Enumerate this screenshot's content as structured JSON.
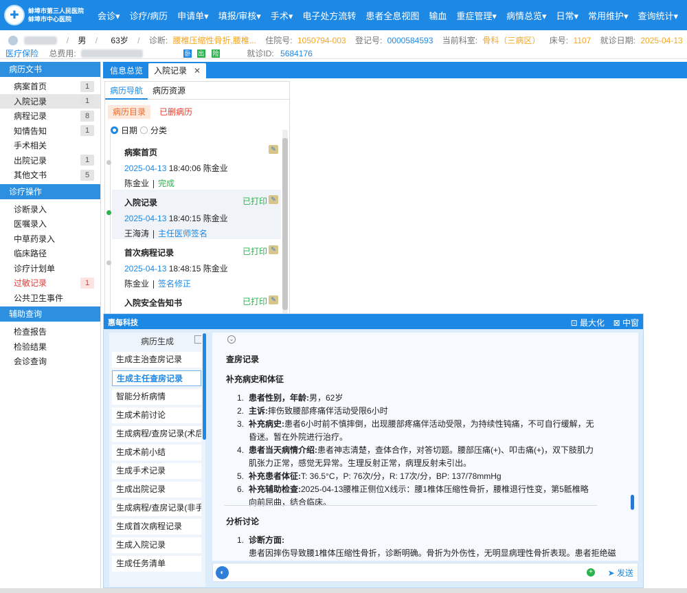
{
  "hospital": {
    "name1": "蚌埠市第三人民医院",
    "name2": "蚌埠市中心医院"
  },
  "menu": [
    "会诊▾",
    "诊疗/病历",
    "申请单▾",
    "填报/审核▾",
    "手术▾",
    "电子处方流转",
    "患者全息视图",
    "输血",
    "重症管理▾",
    "病情总览▾",
    "日常▾",
    "常用维护▾",
    "查询统计▾"
  ],
  "patient": {
    "gender": "男",
    "age": "63岁",
    "diag_label": "诊断:",
    "diag": "腰椎压缩性骨折,腰椎...",
    "inpatient_label": "住院号:",
    "inpatient": "1050794-003",
    "reg_label": "登记号:",
    "reg": "0000584593",
    "dept_label": "当前科室:",
    "dept": "骨科（三病区）",
    "bed_label": "床号:",
    "bed": "1107",
    "visit_label": "就诊日期:",
    "visit": "2025-04-13",
    "insurance": "医疗保险",
    "fee_label": "总费用:",
    "visitid_label": "就诊ID:",
    "visitid": "5684176",
    "badge_a": "卧",
    "badge_b": "出",
    "badge_c": "险"
  },
  "sidebar": {
    "sec1": "病历文书",
    "items1": [
      {
        "label": "病案首页",
        "count": "1"
      },
      {
        "label": "入院记录",
        "count": "1"
      },
      {
        "label": "病程记录",
        "count": "8"
      },
      {
        "label": "知情告知",
        "count": "1"
      },
      {
        "label": "手术相关",
        "count": ""
      },
      {
        "label": "出院记录",
        "count": "1"
      },
      {
        "label": "其他文书",
        "count": "5"
      }
    ],
    "sec2": "诊疗操作",
    "items2": [
      {
        "label": "诊断录入",
        "count": ""
      },
      {
        "label": "医嘱录入",
        "count": ""
      },
      {
        "label": "中草药录入",
        "count": ""
      },
      {
        "label": "临床路径",
        "count": ""
      },
      {
        "label": "诊疗计划单",
        "count": ""
      },
      {
        "label": "过敏记录",
        "count": "1"
      },
      {
        "label": "公共卫生事件",
        "count": ""
      }
    ],
    "sec3": "辅助查询",
    "items3": [
      {
        "label": "检查报告",
        "count": ""
      },
      {
        "label": "检验结果",
        "count": ""
      },
      {
        "label": "会诊查询",
        "count": ""
      }
    ]
  },
  "tabs": {
    "t1": "信息总览",
    "t2": "入院记录",
    "close": "✕"
  },
  "nav": {
    "sub1": "病历导航",
    "sub2": "病历资源",
    "btn1": "病历目录",
    "btn2": "已删病历",
    "r1": "日期",
    "r2": "分类",
    "records": [
      {
        "title": "病案首页",
        "printed": "",
        "date": "2025-04-13",
        "time": "18:40:06",
        "author": "陈金业",
        "signer": "陈金业",
        "status": "完成"
      },
      {
        "title": "入院记录",
        "printed": "已打印",
        "date": "2025-04-13",
        "time": "18:40:15",
        "author": "陈金业",
        "signer": "王海涛",
        "status": "主任医师签名"
      },
      {
        "title": "首次病程记录",
        "printed": "已打印",
        "date": "2025-04-13",
        "time": "18:48:15",
        "author": "陈金业",
        "signer": "陈金业",
        "status": "签名修正"
      },
      {
        "title": "入院安全告知书",
        "printed": "已打印",
        "date": "",
        "time": "",
        "author": "",
        "signer": "",
        "status": ""
      }
    ]
  },
  "ai": {
    "brand": "惠每科技",
    "max": "⊡ 最大化",
    "mid": "⊠ 中窗",
    "list_title": "病历生成",
    "items": [
      "生成主治查房记录",
      "生成主任查房记录",
      "智能分析病情",
      "生成术前讨论",
      "生成病程/查房记录(术后)",
      "生成术前小结",
      "生成手术记录",
      "生成出院记录",
      "生成病程/查房记录(非手术)",
      "生成首次病程记录",
      "生成入院记录",
      "生成任务清单"
    ],
    "content": {
      "h1": "查房记录",
      "h2": "补充病史和体征",
      "list1": [
        {
          "n": "1.",
          "b": "患者性别，年龄:",
          "t": "男，62岁"
        },
        {
          "n": "2.",
          "b": "主诉:",
          "t": "摔伤致腰部疼痛伴活动受限6小时"
        },
        {
          "n": "3.",
          "b": "补充病史:",
          "t": "患者6小时前不慎摔倒，出现腰部疼痛伴活动受限，为持续性钝痛，不可自行缓解，无昏迷。暂在外院进行治疗。"
        },
        {
          "n": "4.",
          "b": "患者当天病情介绍:",
          "t": "患者神志清楚，查体合作，对答切题。腰部压痛(+)、叩击痛(+)，双下肢肌力肌张力正常，感觉无异常。生理反射正常，病理反射未引出。"
        },
        {
          "n": "5.",
          "b": "补充患者体征:",
          "t": "T: 36.5°C，P: 76次/分，R: 17次/分，BP: 137/78mmHg"
        },
        {
          "n": "6.",
          "b": "补充辅助检查:",
          "t": "2025-04-13腰椎正侧位X线示：腰1椎体压缩性骨折，腰椎退行性变，第5骶椎略向前屈曲，结合临床。"
        }
      ],
      "h3": "分析讨论",
      "list2": [
        {
          "n": "1.",
          "b": "诊断方面:",
          "t": ""
        }
      ],
      "p_last": "患者因摔伤导致腰1椎体压缩性骨折，诊断明确。骨折为外伤性，无明显病理性骨折表现。患者拒绝磁"
    },
    "send": "发送"
  }
}
